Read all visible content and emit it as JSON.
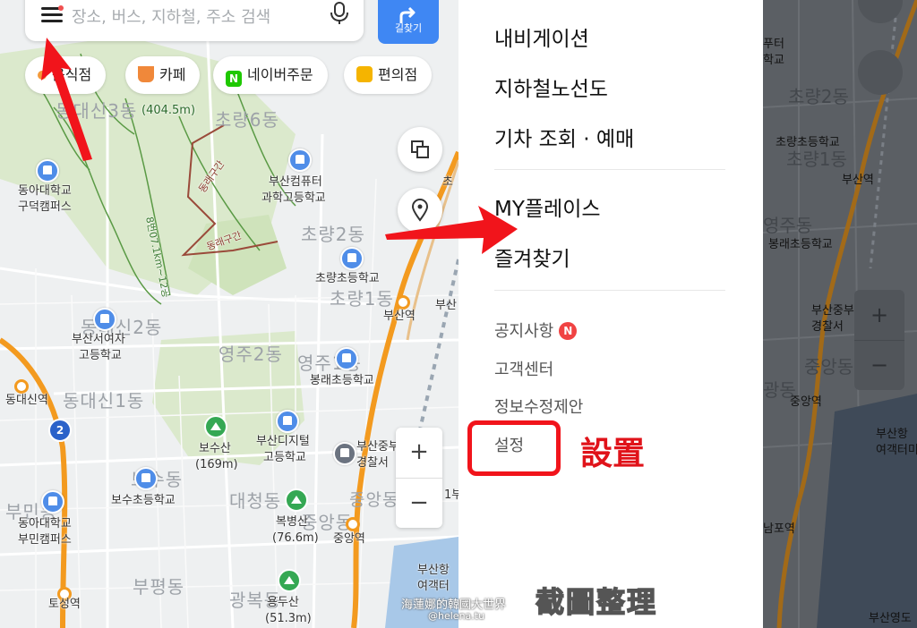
{
  "left_map": {
    "search_placeholder": "장소, 버스, 지하철, 주소 검색",
    "directions_label": "길찾기",
    "categories": [
      {
        "label": "음식점",
        "icon": "fork-icon"
      },
      {
        "label": "카페",
        "icon": "coffee-icon"
      },
      {
        "label": "네이버주문",
        "icon": "naver-n-icon"
      },
      {
        "label": "편의점",
        "icon": "store-icon"
      }
    ],
    "labels": {
      "dongdaesin3": "동대신3동",
      "chorang6": "초량6동",
      "dongdaesin2": "동대신2동",
      "dongdaesin1": "동대신1동",
      "yeongju2": "영주2동",
      "yeongju1": "영주1동",
      "chorang2": "초량2동",
      "chorang1": "초량1동",
      "bosu": "보수동",
      "daecheong": "대청동",
      "bupyeong": "부평동",
      "gwangbok": "광복동",
      "jungang": "중앙동",
      "bumin": "부민동",
      "peak_height": "(404.5m)",
      "dong_a_gudeok_1": "동아대학교",
      "dong_a_gudeok_2": "구덕캠퍼스",
      "busan_computer_1": "부산컴퓨터",
      "busan_computer_2": "과학고등학교",
      "chorang_elem": "초량초등학교",
      "busanseo_girls_1": "부산서여자",
      "busanseo_girls_2": "고등학교",
      "bongnae_elem": "봉래초등학교",
      "digital_1": "부산디지털",
      "digital_2": "고등학교",
      "bosusan": "보수산",
      "bosusan_h": "(169m)",
      "bosu_elem": "보수초등학교",
      "dong_a_bumin_1": "동아대학교",
      "dong_a_bumin_2": "부민캠퍼스",
      "bokbyeongsan": "복병산",
      "bokbyeongsan_h": "(76.6m)",
      "yongdusan": "용두산",
      "yongdusan_h": "(51.3m)",
      "busan_station": "부산역",
      "jungang_station": "중앙역",
      "toseong_station": "토성역",
      "dongdaesin_station": "동대신역",
      "busan_jung_police_1": "부산중부",
      "busan_jung_police_2": "경찰서",
      "busan_port_1": "부산항",
      "busan_port_2": "여객터",
      "jibeon_1": "1부",
      "cho": "초",
      "busan_abbr": "부산",
      "trail_1": "동래구간",
      "trail_2": "동래구간",
      "trail_3": "8번07.1km~12공",
      "line_number": "2"
    }
  },
  "menu": {
    "primary": [
      "내비게이션",
      "지하철노선도",
      "기차 조회 · 예매"
    ],
    "secondary": [
      "MY플레이스",
      "즐겨찾기"
    ],
    "tertiary": [
      "공지사항",
      "고객센터",
      "정보수정제안",
      "설정"
    ],
    "notice_badge": "N"
  },
  "annotation": {
    "settings_label": "設置",
    "watermark": "截圖整理",
    "credit_1": "海蓮娜的韓國大世界",
    "credit_2": "@helena.tu"
  },
  "right_map": {
    "labels": {
      "futer": "푸터",
      "school": "학교",
      "chorang2": "초량2동",
      "chorang_elem": "초량초등학교",
      "chorang1": "초량1동",
      "busan_station": "부산역",
      "yeongju": "영주동",
      "bongnae_elem": "봉래초등학교",
      "busan_jung_1": "부산중부",
      "busan_jung_2": "경찰서",
      "jungang": "중앙동",
      "gwangbok": "광동",
      "jungang_station": "중앙역",
      "busan_port_1": "부산항",
      "busan_port_2": "여객터미",
      "nampo_station": "남포역",
      "busan_yeongdo": "부산영도"
    },
    "zoom_in": "+",
    "zoom_out": "−"
  },
  "colors": {
    "accent_blue": "#3f87f3",
    "annotation_red": "#f1141b",
    "subway_orange": "#f39a1f",
    "park_green": "#dbe9cc"
  }
}
